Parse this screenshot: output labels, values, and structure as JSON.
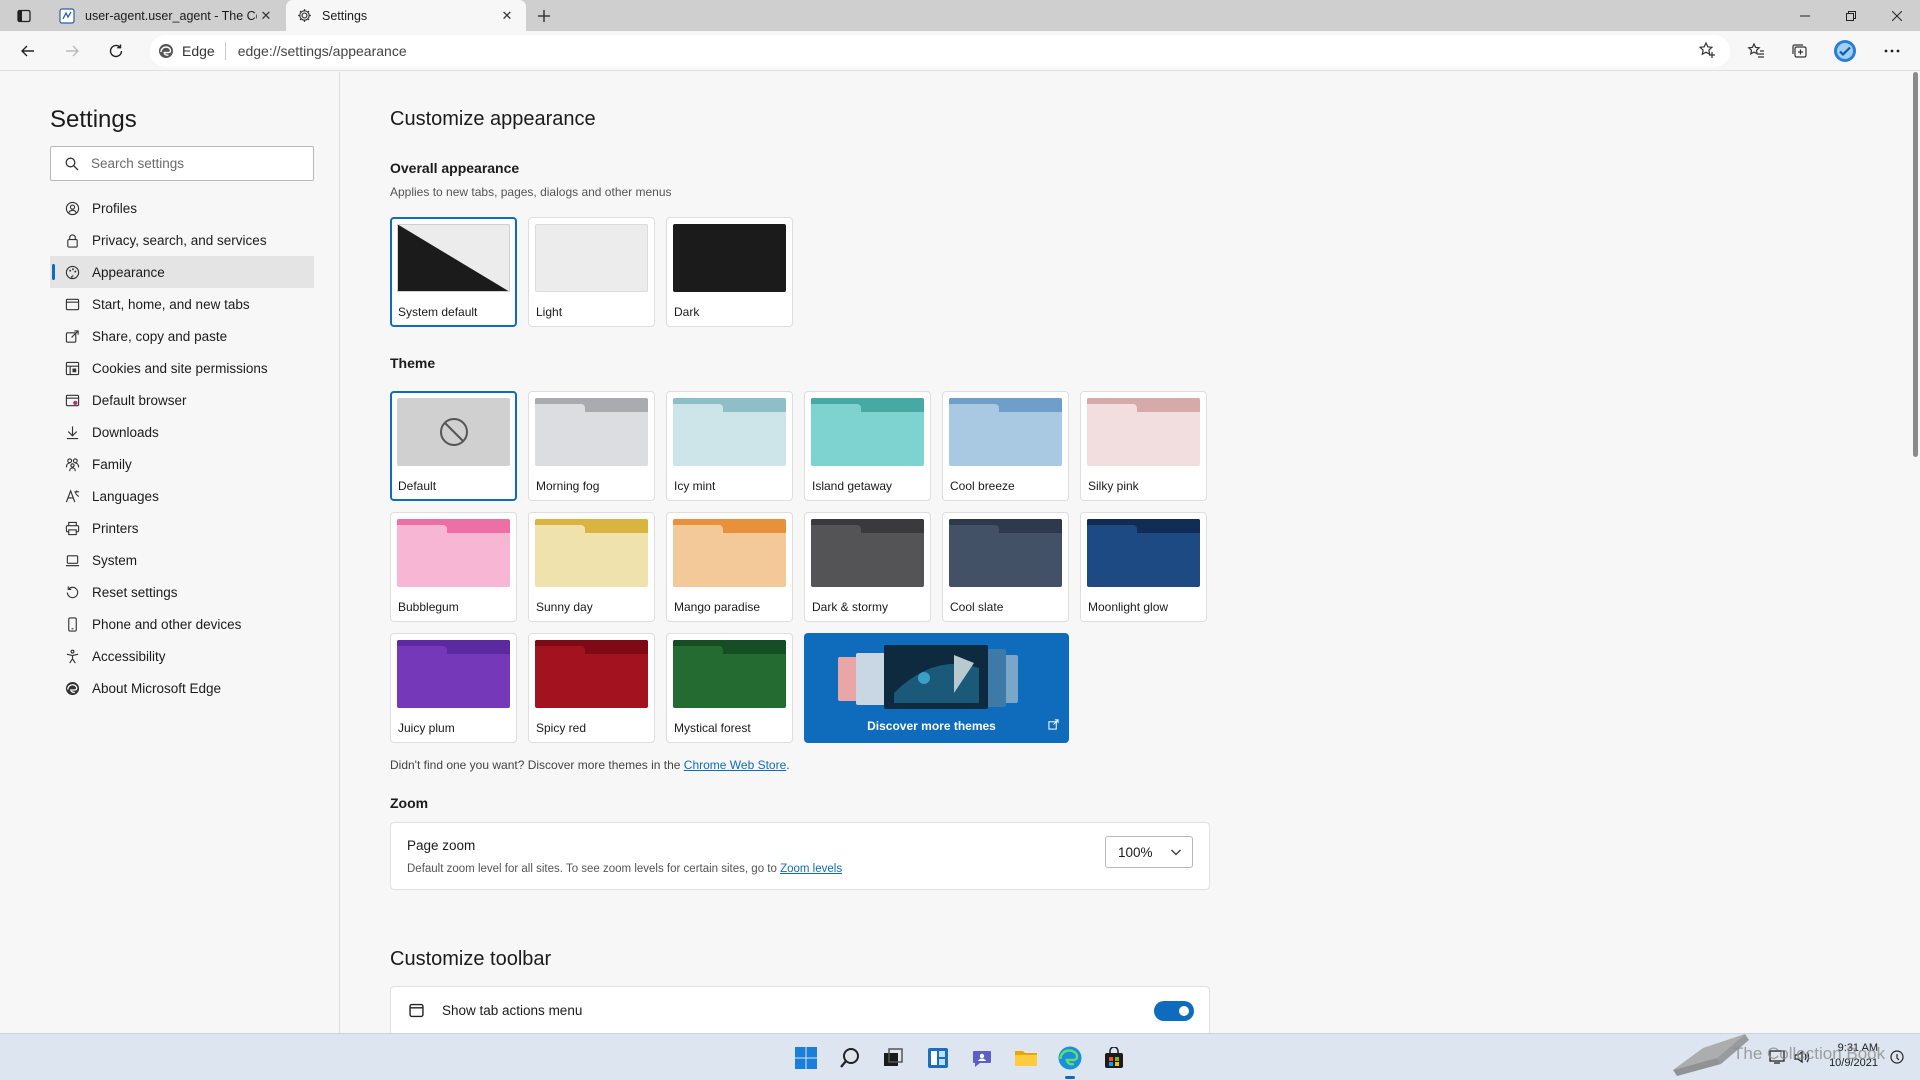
{
  "browser": {
    "tabs": [
      {
        "title": "user-agent.user_agent - The Coll",
        "active": false
      },
      {
        "title": "Settings",
        "active": true
      }
    ],
    "address": {
      "chip": "Edge",
      "url": "edge://settings/appearance"
    }
  },
  "sidebar": {
    "title": "Settings",
    "search_placeholder": "Search settings",
    "items": [
      {
        "label": "Profiles",
        "icon": "profile-icon"
      },
      {
        "label": "Privacy, search, and services",
        "icon": "lock-icon"
      },
      {
        "label": "Appearance",
        "icon": "appearance-icon",
        "selected": true
      },
      {
        "label": "Start, home, and new tabs",
        "icon": "power-icon"
      },
      {
        "label": "Share, copy and paste",
        "icon": "share-icon"
      },
      {
        "label": "Cookies and site permissions",
        "icon": "cookie-icon"
      },
      {
        "label": "Default browser",
        "icon": "browser-icon"
      },
      {
        "label": "Downloads",
        "icon": "download-icon"
      },
      {
        "label": "Family",
        "icon": "family-icon"
      },
      {
        "label": "Languages",
        "icon": "language-icon"
      },
      {
        "label": "Printers",
        "icon": "printer-icon"
      },
      {
        "label": "System",
        "icon": "laptop-icon"
      },
      {
        "label": "Reset settings",
        "icon": "reset-icon"
      },
      {
        "label": "Phone and other devices",
        "icon": "phone-icon"
      },
      {
        "label": "Accessibility",
        "icon": "accessibility-icon"
      },
      {
        "label": "About Microsoft Edge",
        "icon": "edge-icon"
      }
    ]
  },
  "main": {
    "title": "Customize appearance",
    "overall": {
      "heading": "Overall appearance",
      "subtitle": "Applies to new tabs, pages, dialogs and other menus",
      "options": [
        {
          "label": "System default",
          "selected": true
        },
        {
          "label": "Light",
          "selected": false
        },
        {
          "label": "Dark",
          "selected": false
        }
      ]
    },
    "theme": {
      "heading": "Theme",
      "options": [
        {
          "label": "Default",
          "selected": true,
          "top": "#d0d0d0",
          "body": "#d0d0d0"
        },
        {
          "label": "Morning fog",
          "top": "#a9abb0",
          "body": "#dcdde1"
        },
        {
          "label": "Icy mint",
          "top": "#8fbfc6",
          "body": "#cde4e8"
        },
        {
          "label": "Island getaway",
          "top": "#47a9a3",
          "body": "#7ed3d1"
        },
        {
          "label": "Cool breeze",
          "top": "#6e9fc9",
          "body": "#a9c8e1"
        },
        {
          "label": "Silky pink",
          "top": "#d6aaa8",
          "body": "#f2dede"
        },
        {
          "label": "Bubblegum",
          "top": "#ec6fa5",
          "body": "#f7b7d4"
        },
        {
          "label": "Sunny day",
          "top": "#d9b441",
          "body": "#f0e2ad"
        },
        {
          "label": "Mango paradise",
          "top": "#e9913a",
          "body": "#f4c99a"
        },
        {
          "label": "Dark & stormy",
          "top": "#3a3a3c",
          "body": "#545456"
        },
        {
          "label": "Cool slate",
          "top": "#2d3a4d",
          "body": "#435167"
        },
        {
          "label": "Moonlight glow",
          "top": "#112c55",
          "body": "#1d4a82"
        },
        {
          "label": "Juicy plum",
          "top": "#5b2aa1",
          "body": "#7538b8"
        },
        {
          "label": "Spicy red",
          "top": "#7e0a16",
          "body": "#a3131f"
        },
        {
          "label": "Mystical forest",
          "top": "#154d25",
          "body": "#236b31"
        }
      ],
      "discover_label": "Discover more themes",
      "hint_prefix": "Didn't find one you want? Discover more themes in the ",
      "hint_link": "Chrome Web Store",
      "hint_suffix": "."
    },
    "zoom": {
      "heading": "Zoom",
      "title": "Page zoom",
      "description": "Default zoom level for all sites. To see zoom levels for certain sites, go to ",
      "link": "Zoom levels",
      "value": "100%"
    },
    "toolbar": {
      "heading": "Customize toolbar",
      "show_tab_actions": "Show tab actions menu",
      "show_tab_actions_on": true
    }
  },
  "taskbar": {
    "time": "9:31 AM",
    "date": "10/9/2021",
    "watermark": "The Collection Book"
  },
  "colors": {
    "accent": "#0f6cbd",
    "taskbar": "#dde6f0"
  }
}
